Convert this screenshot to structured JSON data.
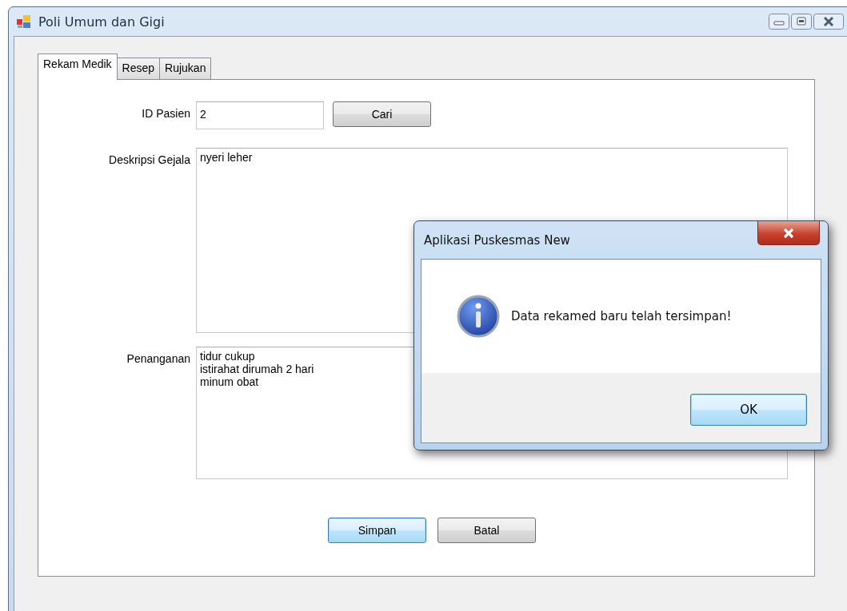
{
  "window": {
    "title": "Poli Umum dan Gigi"
  },
  "tabs": [
    {
      "label": "Rekam Medik",
      "selected": true
    },
    {
      "label": "Resep",
      "selected": false
    },
    {
      "label": "Rujukan",
      "selected": false
    }
  ],
  "form": {
    "id_label": "ID Pasien",
    "id_value": "2",
    "search_button": {
      "label": "Cari",
      "focused": false
    },
    "symptoms_label": "Deskripsi Gejala",
    "symptoms_value": "nyeri leher",
    "treatment_label": "Penanganan",
    "treatment_value": "tidur cukup\nistirahat dirumah 2 hari\nminum obat"
  },
  "buttons": [
    {
      "label": "Simpan",
      "focused": true
    },
    {
      "label": "Batal",
      "focused": false
    }
  ],
  "dialog": {
    "title": "Aplikasi Puskesmas New",
    "message": "Data rekamed baru telah tersimpan!",
    "button": {
      "label": "OK",
      "focused": true
    }
  }
}
